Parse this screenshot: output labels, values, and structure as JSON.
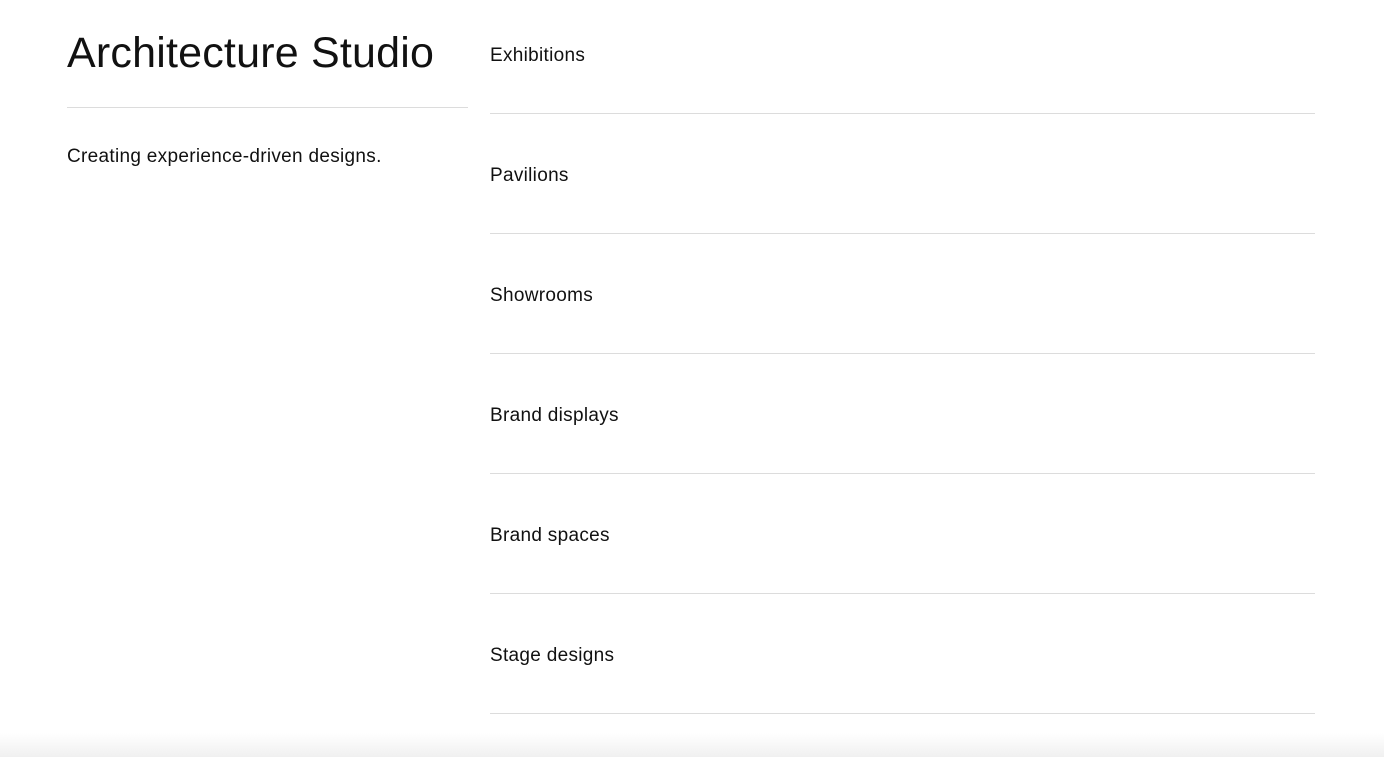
{
  "studio": {
    "title": "Architecture Studio",
    "tagline": "Creating experience-driven designs."
  },
  "services": [
    {
      "label": "Exhibitions"
    },
    {
      "label": "Pavilions"
    },
    {
      "label": "Showrooms"
    },
    {
      "label": "Brand displays"
    },
    {
      "label": "Brand spaces"
    },
    {
      "label": "Stage designs"
    }
  ],
  "colors": {
    "text": "#111111",
    "divider": "#dcdcdc",
    "background": "#ffffff"
  }
}
